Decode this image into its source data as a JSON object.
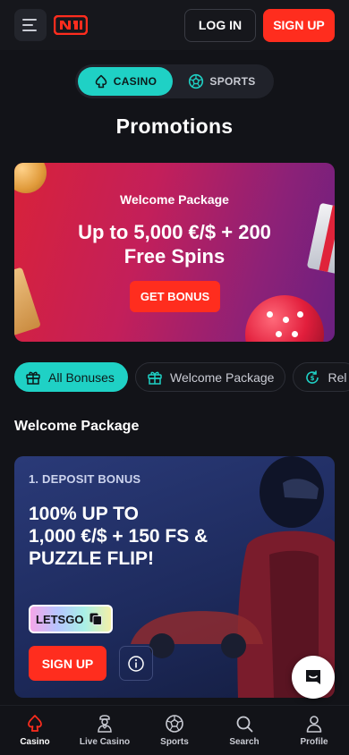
{
  "header": {
    "login_label": "LOG IN",
    "signup_label": "SIGN UP"
  },
  "toggle": {
    "casino_label": "CASINO",
    "sports_label": "SPORTS",
    "active": "CASINO"
  },
  "page": {
    "title": "Promotions"
  },
  "banner": {
    "subtitle": "Welcome Package",
    "headline_line1": "Up to 5,000 €/$ + 200",
    "headline_line2": "Free Spins",
    "cta_label": "GET BONUS"
  },
  "filters": [
    {
      "label": "All Bonuses",
      "icon": "gift-icon",
      "active": true
    },
    {
      "label": "Welcome Package",
      "icon": "gift-icon",
      "active": false
    },
    {
      "label": "Rel",
      "icon": "reload-icon",
      "active": false
    }
  ],
  "section": {
    "heading": "Welcome Package"
  },
  "promo_card": {
    "label": "1. DEPOSIT BONUS",
    "title_line1": "100% UP TO",
    "title_line2": "1,000 €/$ + 150 FS &",
    "title_line3": "PUZZLE FLIP!",
    "code": "LETSGO",
    "signup_label": "SIGN UP"
  },
  "bottom_nav": [
    {
      "label": "Casino",
      "icon": "spade-icon",
      "active": true
    },
    {
      "label": "Live Casino",
      "icon": "dealer-icon",
      "active": false
    },
    {
      "label": "Sports",
      "icon": "soccer-ball-icon",
      "active": false
    },
    {
      "label": "Search",
      "icon": "search-icon",
      "active": false
    },
    {
      "label": "Profile",
      "icon": "user-icon",
      "active": false
    }
  ],
  "colors": {
    "accent_teal": "#1fd1c5",
    "brand_red": "#ff2d1e",
    "background": "#121318"
  }
}
